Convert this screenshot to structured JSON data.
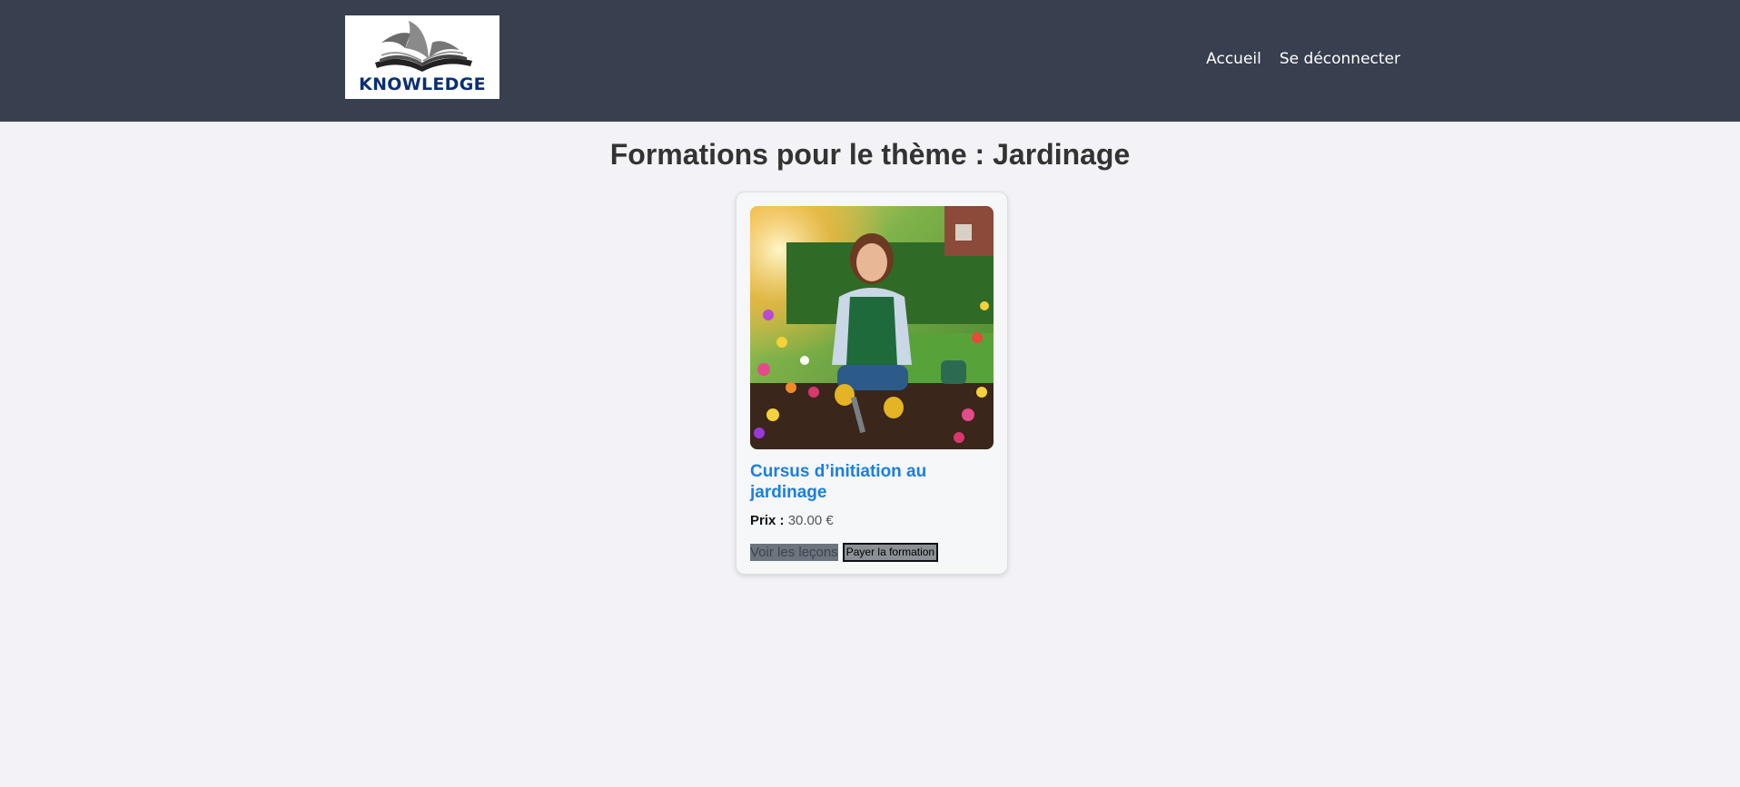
{
  "header": {
    "logo_text": "KNOWLEDGE",
    "nav": [
      {
        "label": "Accueil"
      },
      {
        "label": "Se déconnecter"
      }
    ]
  },
  "main": {
    "title": "Formations pour le thème : Jardinage",
    "courses": [
      {
        "title": "Cursus d’initiation au jardinage",
        "price_label": "Prix :",
        "price_value": "30.00 €",
        "image_icon": "gardening-woman-photo",
        "buttons": {
          "lessons": "Voir les leçons",
          "pay": "Payer la formation"
        }
      }
    ]
  },
  "colors": {
    "header_bg": "#383f4f",
    "page_bg": "#f3f3f7",
    "card_title": "#1a7fe3",
    "logo_text": "#0b2f73"
  }
}
